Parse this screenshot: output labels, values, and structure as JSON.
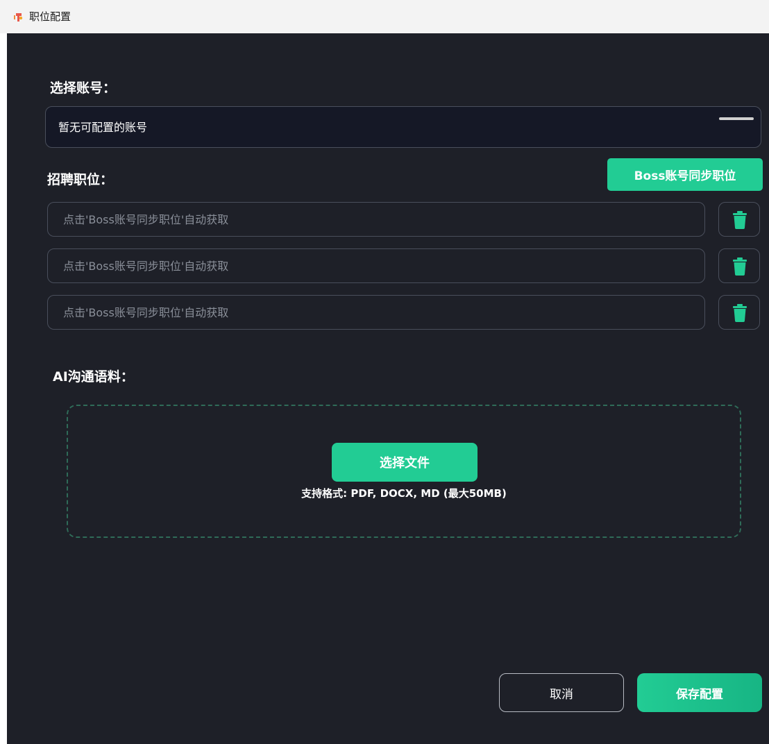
{
  "window": {
    "title": "职位配置",
    "icon": "app-logo-icon"
  },
  "account": {
    "label": "选择账号：",
    "selected_value": "暂无可配置的账号"
  },
  "jobs": {
    "label": "招聘职位：",
    "sync_button": "Boss账号同步职位",
    "placeholder": "点击'Boss账号同步职位'自动获取",
    "rows": [
      {
        "value": "",
        "placeholder": "点击'Boss账号同步职位'自动获取",
        "delete_icon": "trash-icon"
      },
      {
        "value": "",
        "placeholder": "点击'Boss账号同步职位'自动获取",
        "delete_icon": "trash-icon"
      },
      {
        "value": "",
        "placeholder": "点击'Boss账号同步职位'自动获取",
        "delete_icon": "trash-icon"
      }
    ]
  },
  "corpus": {
    "label": "AI沟通语料：",
    "select_file_button": "选择文件",
    "formats_text": "支持格式: PDF, DOCX, MD (最大50MB)"
  },
  "footer": {
    "cancel_label": "取消",
    "save_label": "保存配置"
  },
  "colors": {
    "background": "#1e2028",
    "accent": "#22cc94",
    "border": "#4a4f5c",
    "dashed_border": "#2f6b58"
  }
}
